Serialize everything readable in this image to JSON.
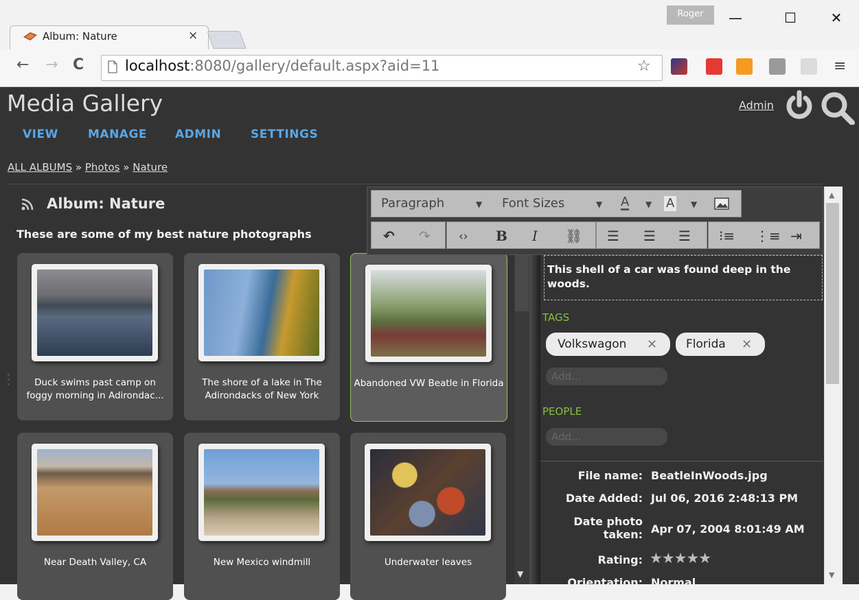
{
  "browser": {
    "tab_title": "Album: Nature",
    "tab_close": "×",
    "user_badge": "Roger",
    "url_host": "localhost",
    "url_rest": ":8080/gallery/default.aspx?aid=11",
    "win_minimize": "—",
    "win_maximize": "☐",
    "win_close": "✕"
  },
  "header": {
    "site_title": "Media Gallery",
    "admin_link": "Admin",
    "menu": [
      "VIEW",
      "MANAGE",
      "ADMIN",
      "SETTINGS"
    ]
  },
  "breadcrumb": {
    "all_albums": "ALL ALBUMS",
    "sep": "»",
    "photos": "Photos",
    "nature": "Nature"
  },
  "album": {
    "title": "Album: Nature",
    "description": "These are some of my best nature photographs",
    "items": [
      {
        "caption": "Duck swims past camp on foggy morning in Adirondac..."
      },
      {
        "caption": "The shore of a lake in The Adirondacks of New York"
      },
      {
        "caption": "Abandoned VW Beatle in Florida"
      },
      {
        "caption": "Near Death Valley, CA"
      },
      {
        "caption": "New Mexico windmill"
      },
      {
        "caption": "Underwater leaves"
      }
    ]
  },
  "editor": {
    "format_select": "Paragraph",
    "size_select": "Font Sizes",
    "font_color_label": "A",
    "bg_color_label": "A",
    "caption": "This shell of a car was found deep in the woods."
  },
  "tags": {
    "label": "TAGS",
    "items": [
      "Volkswagon",
      "Florida"
    ],
    "add_placeholder": "Add..."
  },
  "people": {
    "label": "PEOPLE",
    "add_placeholder": "Add..."
  },
  "meta": {
    "file_name_label": "File name:",
    "file_name": "BeatleInWoods.jpg",
    "date_added_label": "Date Added:",
    "date_added": "Jul 06, 2016 2:48:13 PM",
    "date_taken_label_1": "Date photo",
    "date_taken_label_2": "taken:",
    "date_taken": "Apr 07, 2004 8:01:49 AM",
    "rating_label": "Rating:",
    "rating": 5,
    "rating_stars": "★★★★★",
    "orientation_label": "Orientation:",
    "orientation": "Normal"
  }
}
